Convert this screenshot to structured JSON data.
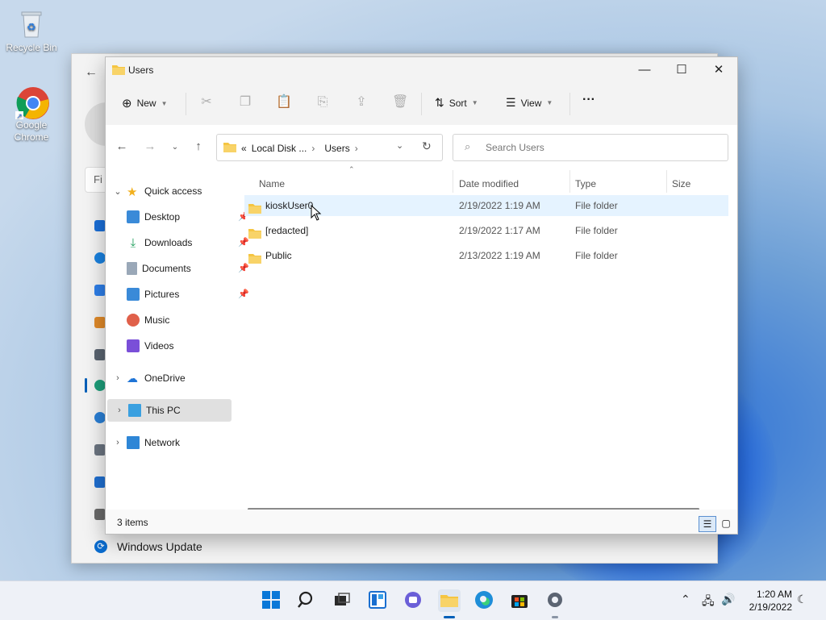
{
  "desktop": {
    "icons": [
      {
        "label": "Recycle Bin"
      },
      {
        "label": "Google Chrome"
      }
    ]
  },
  "settings_window": {
    "find_placeholder": "Fi",
    "windows_update_label": "Windows Update"
  },
  "explorer": {
    "title": "Users",
    "window_buttons": {
      "minimize": "—",
      "maximize": "☐",
      "close": "✕"
    },
    "command_bar": {
      "new_label": "New",
      "sort_label": "Sort",
      "view_label": "View",
      "more_label": "···"
    },
    "address": {
      "prefix": "«",
      "crumbs": [
        "Local Disk ...",
        "Users"
      ]
    },
    "search_placeholder": "Search Users",
    "sidebar": {
      "quick_access": "Quick access",
      "items": [
        {
          "label": "Desktop",
          "pinned": true
        },
        {
          "label": "Downloads",
          "pinned": true
        },
        {
          "label": "Documents",
          "pinned": true
        },
        {
          "label": "Pictures",
          "pinned": true
        },
        {
          "label": "Music",
          "pinned": false
        },
        {
          "label": "Videos",
          "pinned": false
        }
      ],
      "onedrive": "OneDrive",
      "this_pc": "This PC",
      "network": "Network"
    },
    "columns": [
      "Name",
      "Date modified",
      "Type",
      "Size"
    ],
    "files": [
      {
        "name": "kioskUser0",
        "date": "2/19/2022 1:19 AM",
        "type": "File folder"
      },
      {
        "name": "[redacted]",
        "date": "2/19/2022 1:17 AM",
        "type": "File folder"
      },
      {
        "name": "Public",
        "date": "2/13/2022 1:19 AM",
        "type": "File folder"
      }
    ],
    "status": "3 items"
  },
  "taskbar": {
    "time": "1:20 AM",
    "date": "2/19/2022"
  },
  "colors": {
    "accent": "#005fb8",
    "folder": "#f5c542",
    "hover_row": "#e5f3ff"
  }
}
